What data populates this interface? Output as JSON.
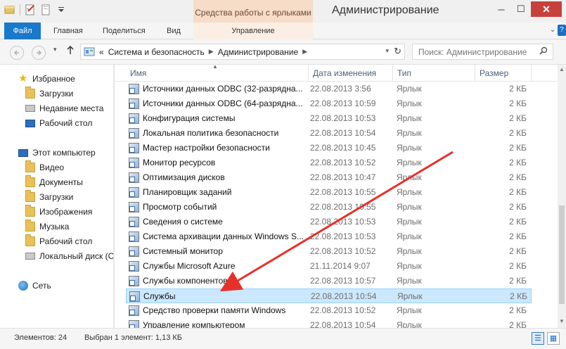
{
  "window": {
    "title": "Администрирование",
    "context_tab_header": "Средства работы с ярлыками",
    "minimize": "─",
    "maximize": "☐",
    "close": "✕"
  },
  "ribbon": {
    "tabs": [
      {
        "label": "Файл"
      },
      {
        "label": "Главная"
      },
      {
        "label": "Поделиться"
      },
      {
        "label": "Вид"
      },
      {
        "label": "Управление"
      }
    ],
    "expand": "⌄",
    "help": "?"
  },
  "address": {
    "prefix": "«",
    "crumbs": [
      "Система и безопасность",
      "Администрирование"
    ],
    "search_placeholder": "Поиск: Администрирование"
  },
  "nav": {
    "favorites_label": "Избранное",
    "favorites": [
      {
        "label": "Загрузки",
        "icon": "folder-icon"
      },
      {
        "label": "Недавние места",
        "icon": "recent-places-icon"
      },
      {
        "label": "Рабочий стол",
        "icon": "desktop-icon"
      }
    ],
    "computer_label": "Этот компьютер",
    "computer": [
      {
        "label": "Видео",
        "icon": "folder-icon"
      },
      {
        "label": "Документы",
        "icon": "folder-icon"
      },
      {
        "label": "Загрузки",
        "icon": "folder-icon"
      },
      {
        "label": "Изображения",
        "icon": "folder-icon"
      },
      {
        "label": "Музыка",
        "icon": "folder-icon"
      },
      {
        "label": "Рабочий стол",
        "icon": "folder-icon"
      },
      {
        "label": "Локальный диск (С",
        "icon": "disk-icon"
      }
    ],
    "network_label": "Сеть"
  },
  "columns": {
    "name": "Имя",
    "date": "Дата изменения",
    "type": "Тип",
    "size": "Размер"
  },
  "files": [
    {
      "name": "Источники данных ODBC (32-разрядна...",
      "date": "22.08.2013 3:56",
      "type": "Ярлык",
      "size": "2 КБ"
    },
    {
      "name": "Источники данных ODBC (64-разрядна...",
      "date": "22.08.2013 10:59",
      "type": "Ярлык",
      "size": "2 КБ"
    },
    {
      "name": "Конфигурация системы",
      "date": "22.08.2013 10:53",
      "type": "Ярлык",
      "size": "2 КБ"
    },
    {
      "name": "Локальная политика безопасности",
      "date": "22.08.2013 10:54",
      "type": "Ярлык",
      "size": "2 КБ"
    },
    {
      "name": "Мастер настройки безопасности",
      "date": "22.08.2013 10:45",
      "type": "Ярлык",
      "size": "2 КБ"
    },
    {
      "name": "Монитор ресурсов",
      "date": "22.08.2013 10:52",
      "type": "Ярлык",
      "size": "2 КБ"
    },
    {
      "name": "Оптимизация дисков",
      "date": "22.08.2013 10:47",
      "type": "Ярлык",
      "size": "2 КБ"
    },
    {
      "name": "Планировщик заданий",
      "date": "22.08.2013 10:55",
      "type": "Ярлык",
      "size": "2 КБ"
    },
    {
      "name": "Просмотр событий",
      "date": "22.08.2013 10:55",
      "type": "Ярлык",
      "size": "2 КБ"
    },
    {
      "name": "Сведения о системе",
      "date": "22.08.2013 10:53",
      "type": "Ярлык",
      "size": "2 КБ"
    },
    {
      "name": "Система архивации данных Windows S...",
      "date": "22.08.2013 10:53",
      "type": "Ярлык",
      "size": "2 КБ"
    },
    {
      "name": "Системный монитор",
      "date": "22.08.2013 10:52",
      "type": "Ярлык",
      "size": "2 КБ"
    },
    {
      "name": "Службы Microsoft Azure",
      "date": "21.11.2014 9:07",
      "type": "Ярлык",
      "size": "2 КБ"
    },
    {
      "name": "Службы компонентов",
      "date": "22.08.2013 10:57",
      "type": "Ярлык",
      "size": "2 КБ"
    },
    {
      "name": "Службы",
      "date": "22.08.2013 10:54",
      "type": "Ярлык",
      "size": "2 КБ",
      "selected": true
    },
    {
      "name": "Средство проверки памяти Windows",
      "date": "22.08.2013 10:52",
      "type": "Ярлык",
      "size": "2 КБ"
    },
    {
      "name": "Управление компьютером",
      "date": "22.08.2013 10:54",
      "type": "Ярлык",
      "size": "2 КБ"
    }
  ],
  "status": {
    "count": "Элементов: 24",
    "selection": "Выбран 1 элемент: 1,13 КБ"
  },
  "colors": {
    "accent": "#1979ca",
    "selection": "#cce8ff",
    "arrow": "#e8302a"
  }
}
